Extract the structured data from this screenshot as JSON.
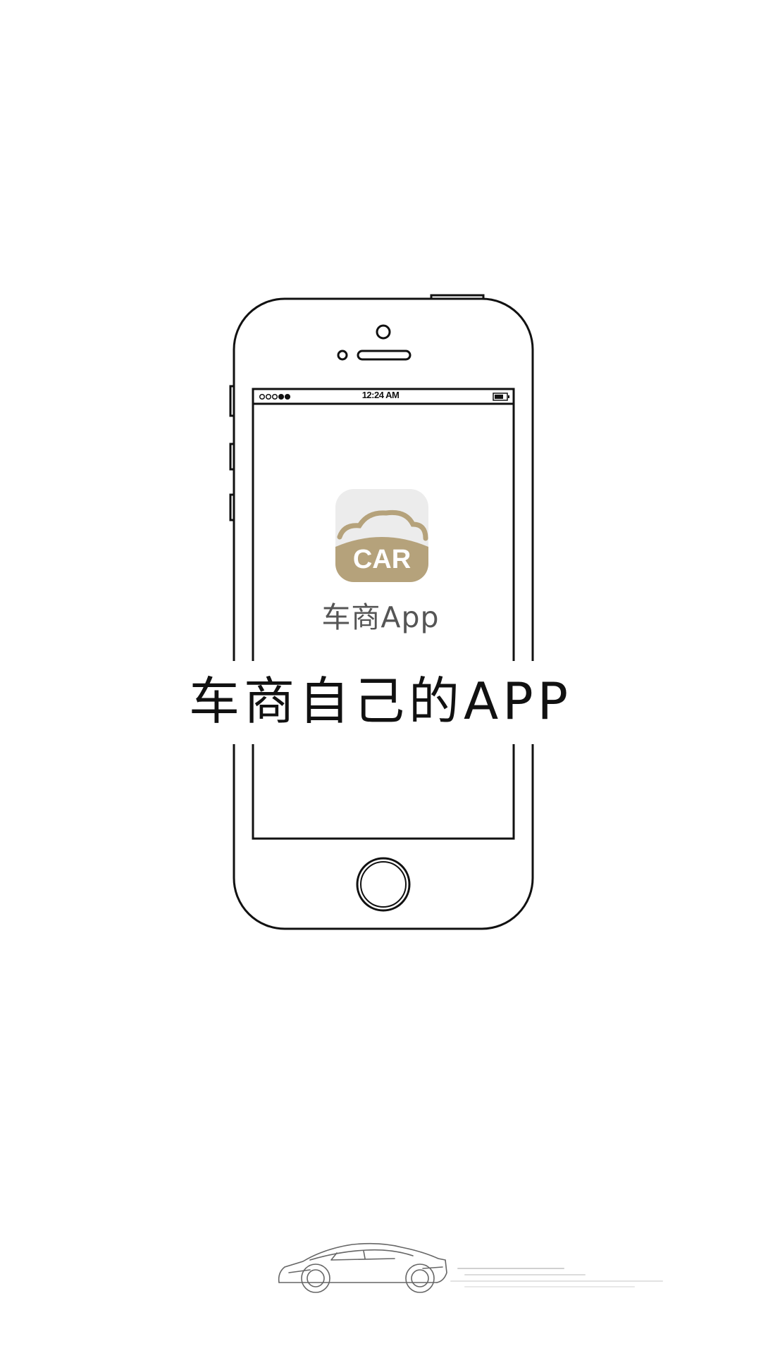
{
  "status_bar": {
    "time": "12:24 AM"
  },
  "app_icon": {
    "label": "CAR",
    "colors": {
      "background": "#ececec",
      "brand": "#b5a27b",
      "text": "#ffffff"
    }
  },
  "app_name": "车商App",
  "tagline": "车商自己的APP",
  "icons": {
    "phone": "phone-outline-icon",
    "car": "sports-car-icon",
    "home_button": "home-button-icon"
  }
}
